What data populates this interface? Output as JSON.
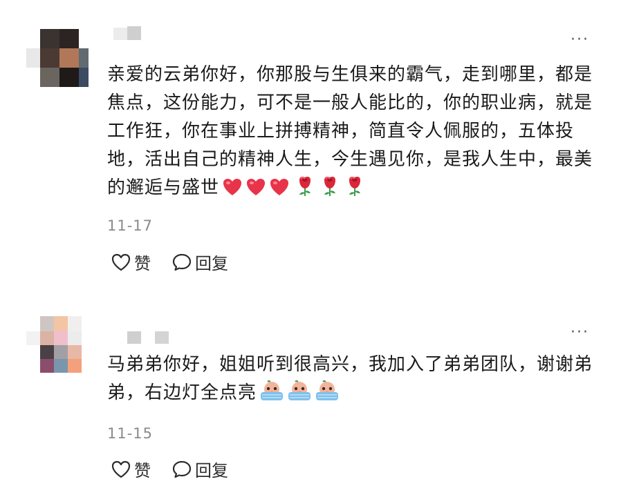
{
  "comments": [
    {
      "text": "亲爱的云弟你好，你那股与生俱来的霸气，走到哪里，都是焦点，这份能力，可不是一般人能比的，你的职业病，就是工作狂，你在事业上拼搏精神，简直令人佩服的，五体投地，活出自己的精神人生，今生遇见你，是我人生中，最美的邂逅与盛世",
      "emojis": [
        "red-heart-icon",
        "red-heart-icon",
        "red-heart-icon",
        "rose-icon",
        "rose-icon",
        "rose-icon"
      ],
      "date": "11-17",
      "like_label": "赞",
      "reply_label": "回复",
      "more_label": "···"
    },
    {
      "text": "马弟弟你好，姐姐听到很高兴，我加入了弟弟团队，谢谢弟弟，右边灯全点亮",
      "emojis": [
        "crying-face-icon",
        "crying-face-icon",
        "crying-face-icon"
      ],
      "date": "11-15",
      "like_label": "赞",
      "reply_label": "回复",
      "more_label": "···"
    }
  ],
  "colors": {
    "text": "#1a1a1a",
    "date": "#8a8a8a",
    "heart": "#e8344a",
    "rose": "#d9283a",
    "leaf": "#3a9a4a"
  }
}
